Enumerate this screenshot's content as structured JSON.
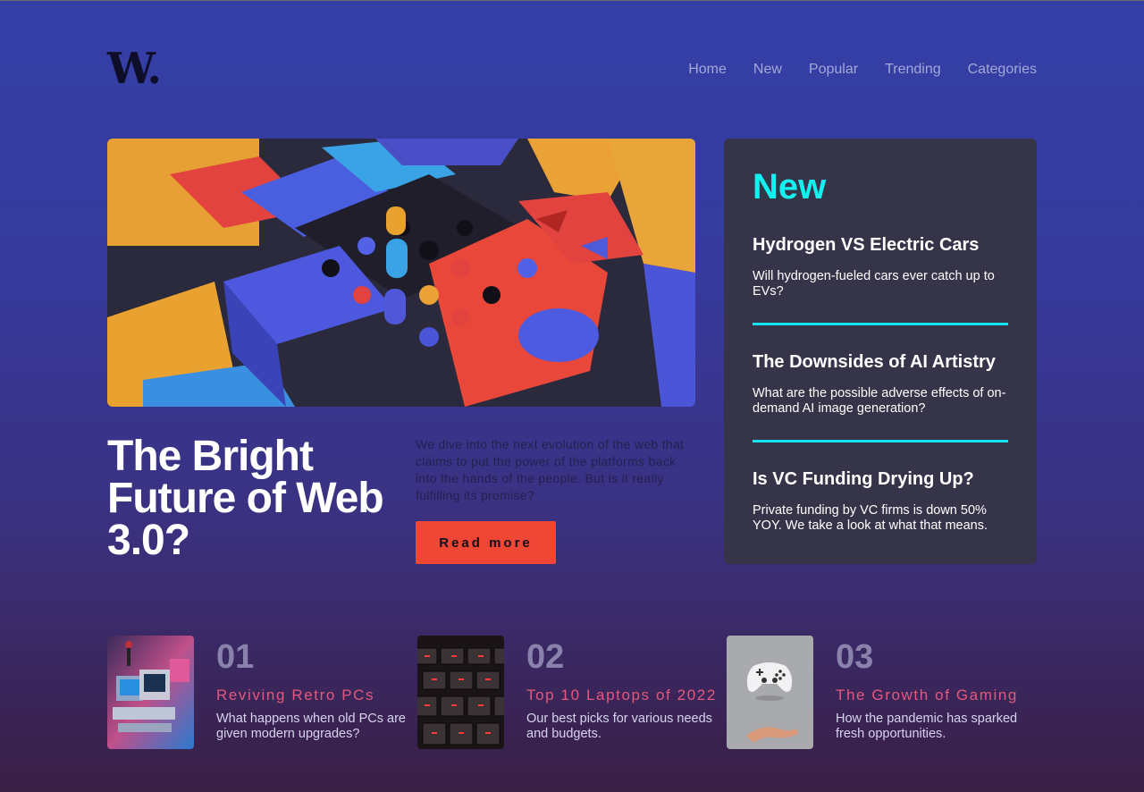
{
  "brand": {
    "logo_text": "W."
  },
  "nav": {
    "items": [
      "Home",
      "New",
      "Popular",
      "Trending",
      "Categories"
    ]
  },
  "hero": {
    "image_icon": "abstract-blocks-illustration",
    "title": "The Bright Future of Web 3.0?",
    "description": "We dive into the next evolution of the web that claims to put the power of the platforms back into the hands of the people. But is it really fulfilling its promise?",
    "cta_label": "Read more"
  },
  "new_panel": {
    "heading": "New",
    "items": [
      {
        "title": "Hydrogen VS Electric Cars",
        "description": "Will hydrogen-fueled cars ever catch up to EVs?"
      },
      {
        "title": "The Downsides of AI Artistry",
        "description": "What are the possible adverse effects of on-demand AI image generation?"
      },
      {
        "title": "Is VC Funding Drying Up?",
        "description": "Private funding by VC firms is down 50% YOY. We take a look at what that means."
      }
    ]
  },
  "featured": [
    {
      "number": "01",
      "title": "Reviving Retro PCs",
      "description": "What happens when old PCs are given modern upgrades?",
      "image_icon": "retro-pc-photo"
    },
    {
      "number": "02",
      "title": "Top 10 Laptops of 2022",
      "description": "Our best picks for various needs and budgets.",
      "image_icon": "keyboard-photo"
    },
    {
      "number": "03",
      "title": "The Growth of Gaming",
      "description": "How the pandemic has sparked fresh opportunities.",
      "image_icon": "gamepad-photo"
    }
  ],
  "colors": {
    "accent_cyan": "#14e2ec",
    "accent_red": "#ef4636",
    "panel_bg": "#363449"
  }
}
